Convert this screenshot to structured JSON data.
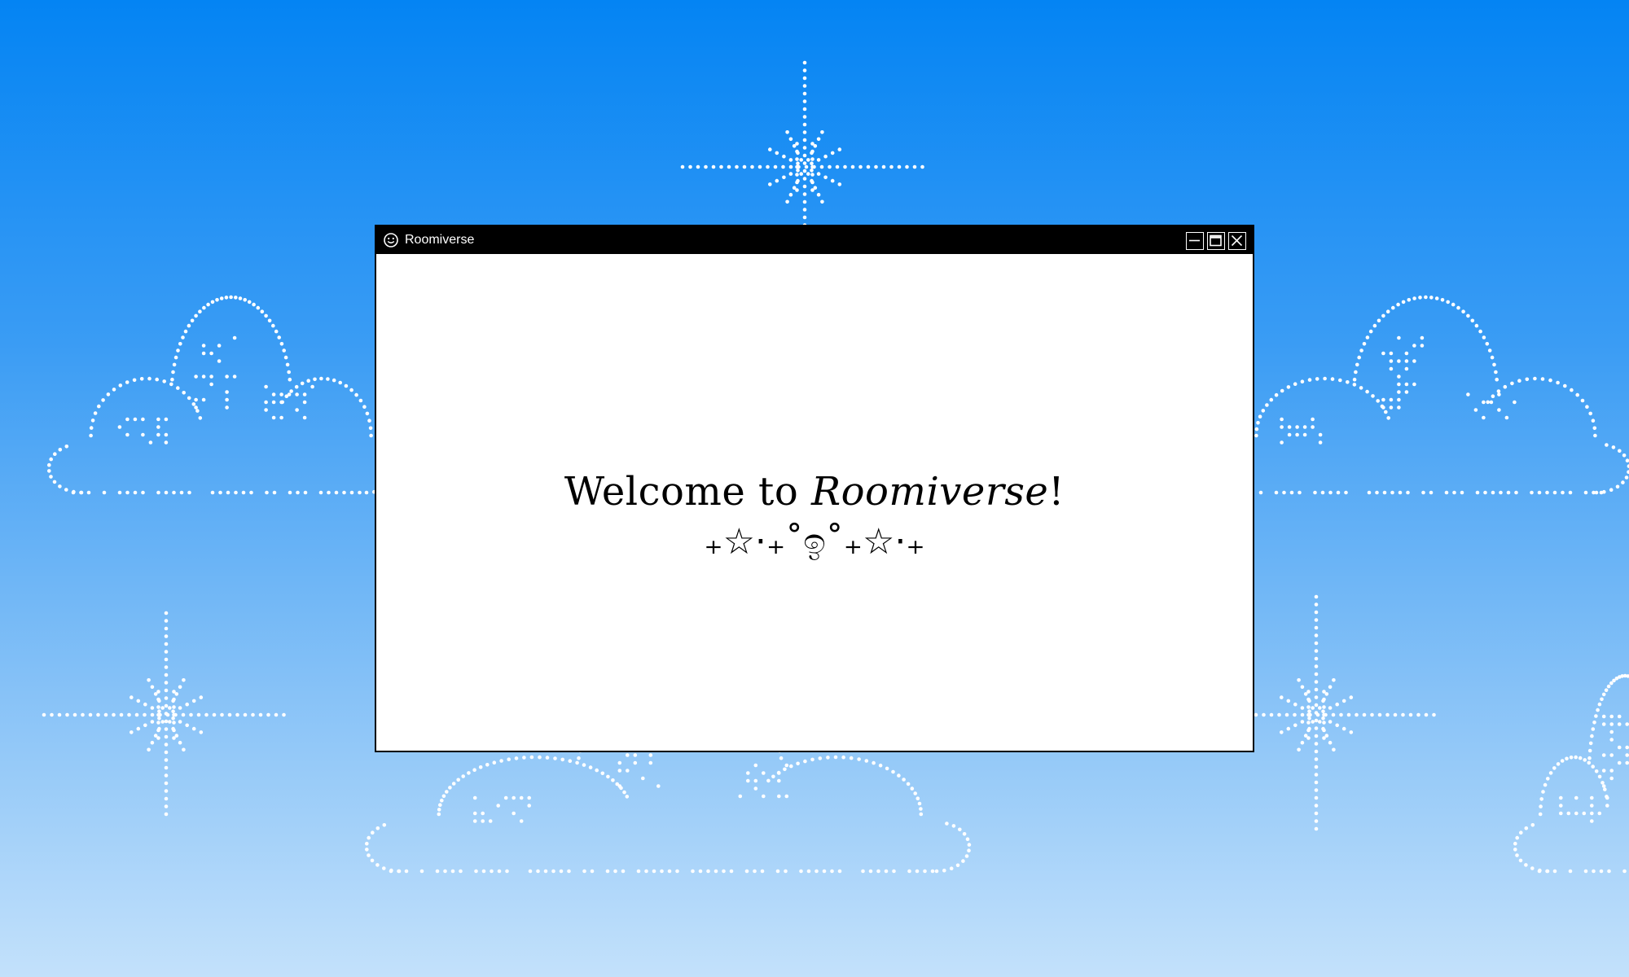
{
  "window": {
    "title": "Roomiverse",
    "app_icon": "smiley-face-icon",
    "controls": {
      "minimize_icon": "minimize-icon",
      "maximize_icon": "maximize-icon",
      "close_icon": "close-icon"
    }
  },
  "content": {
    "welcome_prefix": "Welcome to ",
    "welcome_name": "Roomiverse",
    "welcome_suffix": "!",
    "decoration": "₊☆⋅₊˚ඉ˚₊☆⋅₊"
  },
  "background": {
    "description_icons": [
      "dotted-cloud-icon",
      "dotted-sparkle-icon"
    ],
    "gradient_top": "#0484f3",
    "gradient_bottom": "#c3e1fb",
    "dot_color": "#ffffff"
  },
  "colors": {
    "titlebar": "#000000",
    "window_bg": "#ffffff",
    "text": "#000000"
  }
}
